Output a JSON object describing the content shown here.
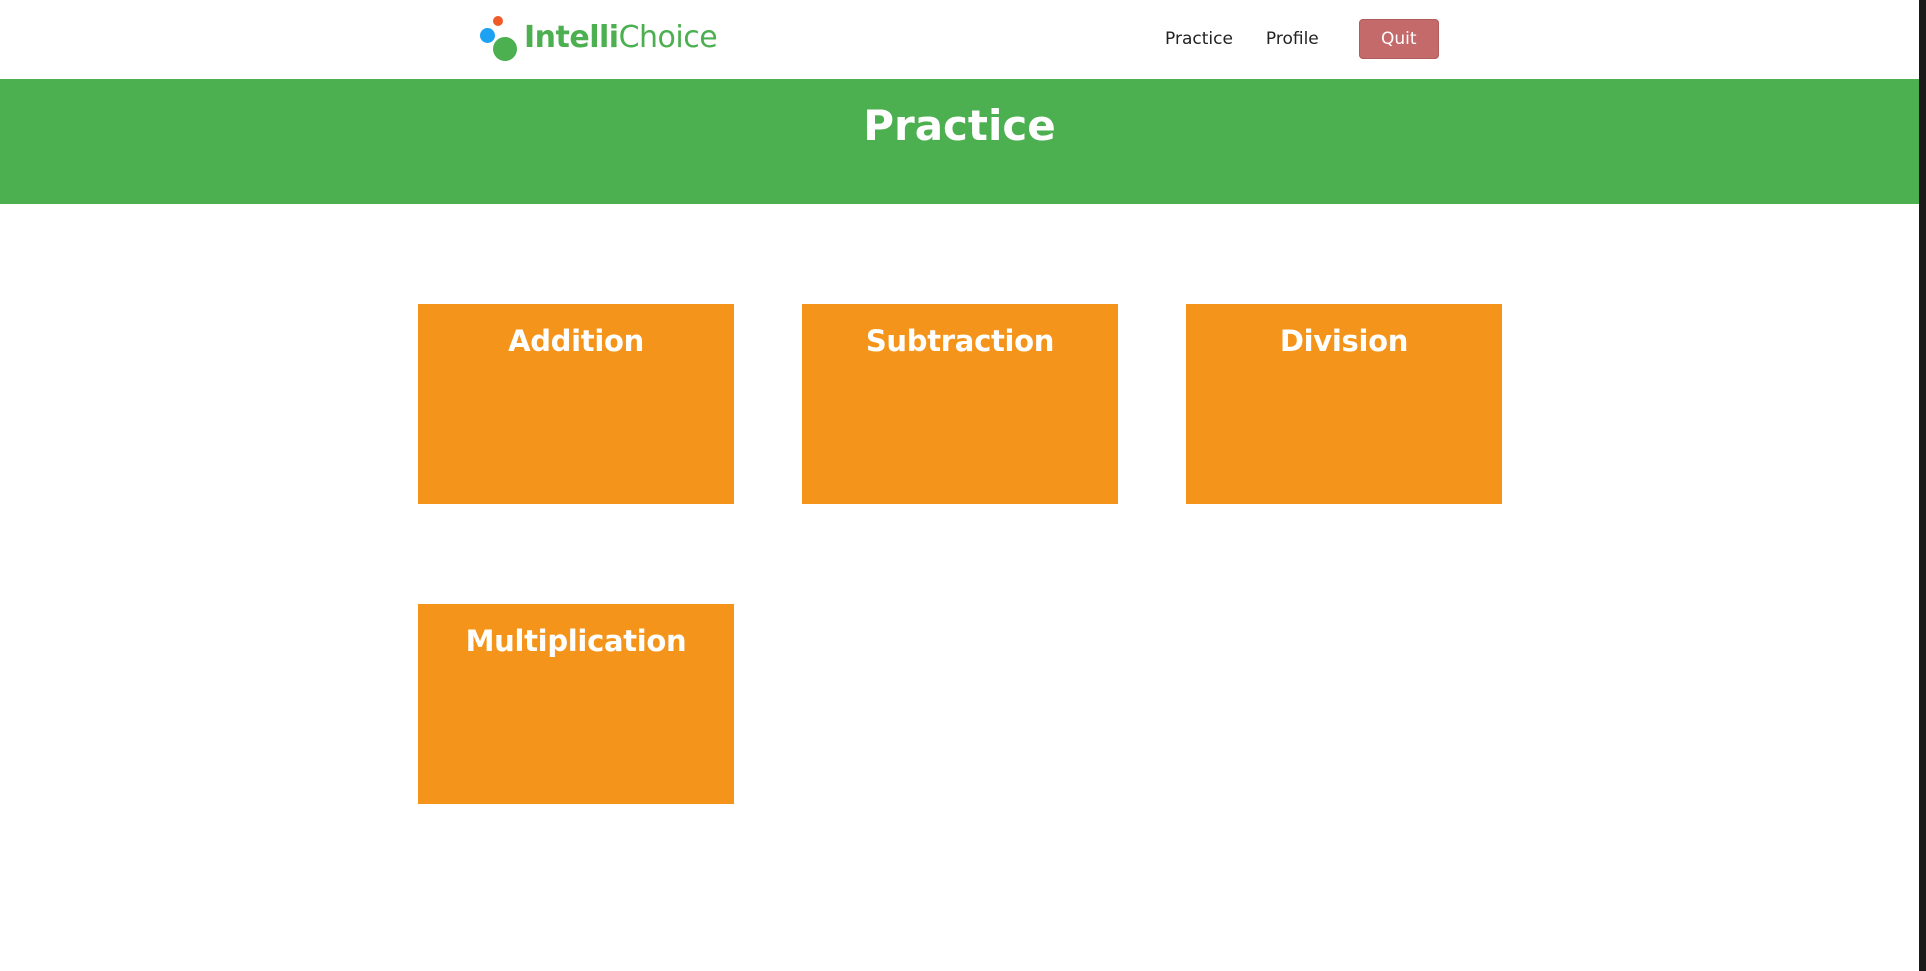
{
  "app": {
    "logo_bold": "Intelli",
    "logo_light": "Choice"
  },
  "nav": {
    "practice_label": "Practice",
    "profile_label": "Profile",
    "quit_label": "Quit"
  },
  "banner": {
    "title": "Practice"
  },
  "cards": [
    {
      "label": "Addition"
    },
    {
      "label": "Subtraction"
    },
    {
      "label": "Division"
    },
    {
      "label": "Multiplication"
    }
  ],
  "colors": {
    "brand_green": "#4caf50",
    "card_orange": "#f4941a",
    "quit_red": "#c56a6a",
    "logo_dot_red": "#f05a28",
    "logo_dot_blue": "#1da1f2"
  },
  "icons": {
    "logo": "intellichoice-dots-logo-icon"
  }
}
